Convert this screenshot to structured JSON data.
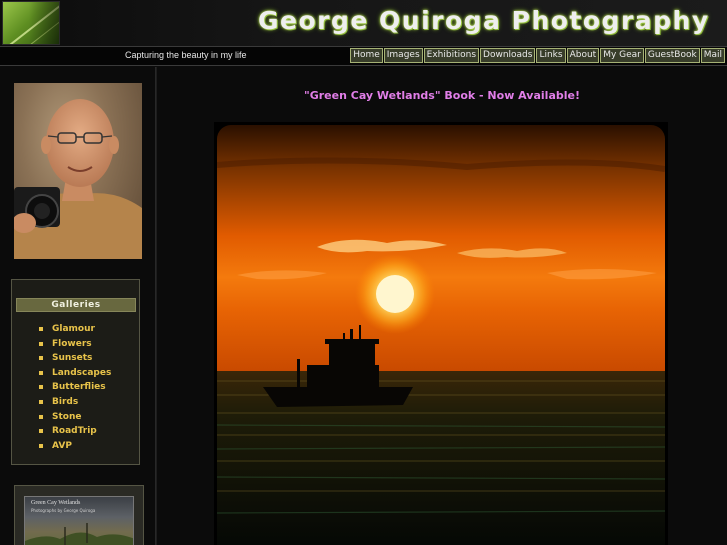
{
  "header": {
    "title": "George Quiroga Photography",
    "logo_icon": "leaf-icon"
  },
  "navbar": {
    "tagline": "Capturing the beauty in my life",
    "links": [
      {
        "label": "Home"
      },
      {
        "label": "Images"
      },
      {
        "label": "Exhibitions"
      },
      {
        "label": "Downloads"
      },
      {
        "label": "Links"
      },
      {
        "label": "About"
      },
      {
        "label": "My Gear"
      },
      {
        "label": "GuestBook"
      },
      {
        "label": "Mail"
      }
    ]
  },
  "sidebar": {
    "galleries_title": "Galleries",
    "galleries": [
      {
        "label": "Glamour"
      },
      {
        "label": "Flowers"
      },
      {
        "label": "Sunsets"
      },
      {
        "label": "Landscapes"
      },
      {
        "label": "Butterflies"
      },
      {
        "label": "Birds"
      },
      {
        "label": "Stone"
      },
      {
        "label": "RoadTrip"
      },
      {
        "label": "AVP"
      }
    ],
    "book": {
      "title": "Green Cay Wetlands",
      "subtitle": "Photographs by George Quiroga"
    }
  },
  "main": {
    "announcement": "\"Green Cay Wetlands\" Book - Now Available!"
  },
  "colors": {
    "accent_gold": "#e8c34a",
    "announcement_pink": "#e17ee8",
    "nav_border": "#a6b275"
  }
}
